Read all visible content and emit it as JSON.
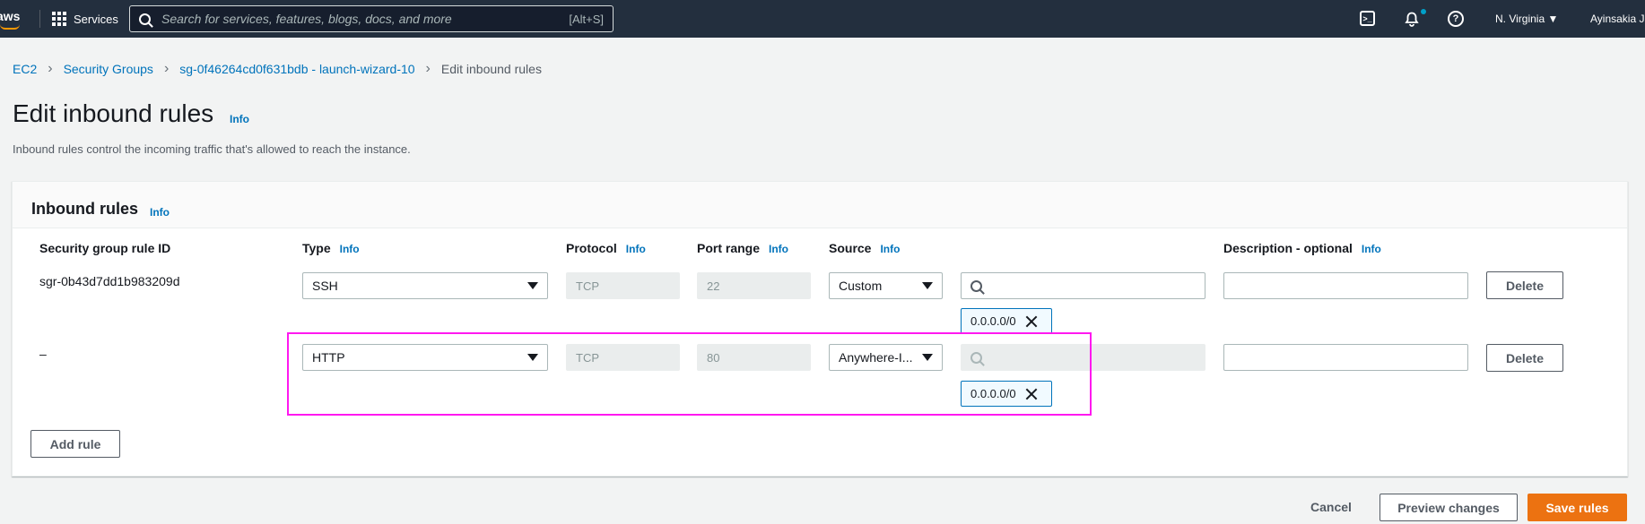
{
  "topnav": {
    "logo_text": "aws",
    "services_label": "Services",
    "search_placeholder": "Search for services, features, blogs, docs, and more",
    "search_shortcut": "[Alt+S]",
    "region": "N. Virginia ▼",
    "user": "Ayinsakia J"
  },
  "breadcrumb": [
    {
      "label": "EC2"
    },
    {
      "label": "Security Groups"
    },
    {
      "label": "sg-0f46264cd0f631bdb - launch-wizard-10"
    },
    {
      "label": "Edit inbound rules"
    }
  ],
  "header": {
    "title": "Edit inbound rules",
    "info": "Info",
    "description": "Inbound rules control the incoming traffic that's allowed to reach the instance."
  },
  "inbound": {
    "title": "Inbound rules",
    "info": "Info",
    "columns": {
      "rule_id": "Security group rule ID",
      "type": "Type",
      "protocol": "Protocol",
      "port_range": "Port range",
      "source": "Source",
      "description": "Description - optional"
    },
    "column_info": "Info",
    "rules": [
      {
        "id": "sgr-0b43d7dd1b983209d",
        "type": "SSH",
        "protocol": "TCP",
        "port": "22",
        "source": "Custom",
        "cidr": "0.0.0.0/0",
        "description": "",
        "delete": "Delete"
      },
      {
        "id": "–",
        "type": "HTTP",
        "protocol": "TCP",
        "port": "80",
        "source": "Anywhere-I...",
        "cidr": "0.0.0.0/0",
        "description": "",
        "delete": "Delete"
      }
    ],
    "add_rule": "Add rule"
  },
  "footer": {
    "cancel": "Cancel",
    "preview": "Preview changes",
    "save": "Save rules"
  }
}
